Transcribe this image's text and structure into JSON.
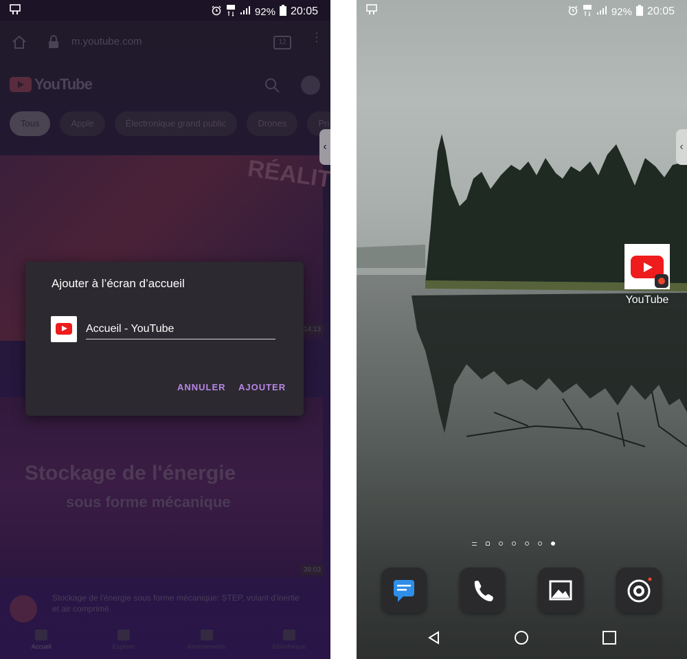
{
  "left": {
    "status": {
      "battery": "92%",
      "time": "20:05"
    },
    "browser": {
      "url": "m.youtube.com",
      "tab_count": "12"
    },
    "youtube": {
      "logo_text": "YouTube",
      "chips": [
        "Tous",
        "Apple",
        "Électronique grand public",
        "Drones",
        "Pri"
      ],
      "thumb1_text": "RÉALITÉ",
      "thumb1_duration": "14:13",
      "thumb2_line1": "Stockage de l'énergie",
      "thumb2_line2": "sous forme mécanique",
      "thumb2_duration": "39:03",
      "video_title": "Stockage de l'énergie sous forme mécanique: STEP, volant d'inertie et air comprimé.",
      "nav": [
        "Accueil",
        "Explorer",
        "Abonnements",
        "Bibliothèque"
      ]
    },
    "dialog": {
      "title": "Ajouter à l’écran d’accueil",
      "field_value": "Accueil - YouTube",
      "cancel_label": "ANNULER",
      "add_label": "AJOUTER"
    }
  },
  "right": {
    "status": {
      "battery": "92%",
      "time": "20:05"
    },
    "shortcut_label": "YouTube",
    "dock": [
      "messages-icon",
      "phone-icon",
      "gallery-icon",
      "camera-icon"
    ]
  },
  "colors": {
    "accent": "#b787e6",
    "youtube_red": "#ee1c1c"
  }
}
